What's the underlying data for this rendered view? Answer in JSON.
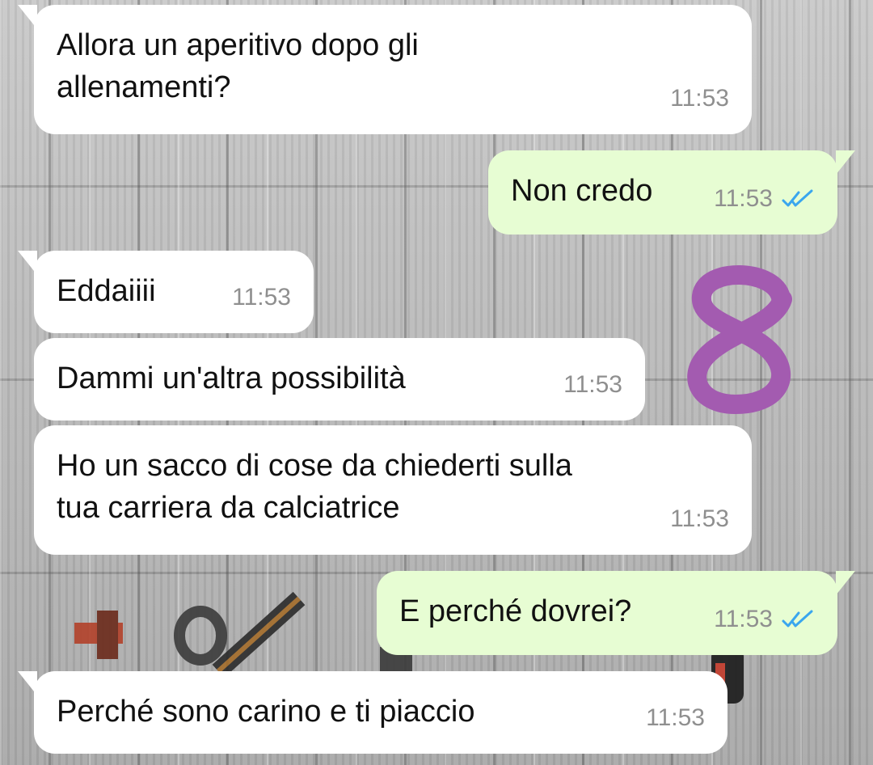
{
  "messages": [
    {
      "direction": "incoming",
      "text": "Allora un aperitivo dopo gli\nallenamenti?",
      "time": "11:53"
    },
    {
      "direction": "outgoing",
      "text": "Non credo",
      "time": "11:53",
      "status": "read-double-tick"
    },
    {
      "direction": "incoming",
      "text": "Eddaiiii",
      "time": "11:53"
    },
    {
      "direction": "incoming",
      "text": "Dammi un'altra possibilità",
      "time": "11:53"
    },
    {
      "direction": "incoming",
      "text": "Ho un sacco di cose da chiederti sulla\ntua carriera da calciatrice",
      "time": "11:53"
    },
    {
      "direction": "outgoing",
      "text": "E perché dovrei?",
      "time": "11:53",
      "status": "read-double-tick"
    },
    {
      "direction": "incoming",
      "text": "Perché sono carino e ti piaccio",
      "time": "11:53"
    }
  ],
  "overlay": {
    "annotation": "8",
    "annotation_color": "#a35bb0"
  },
  "colors": {
    "incoming_bubble": "#ffffff",
    "outgoing_bubble": "#e7fdd3",
    "timestamp": "#8f8f8f",
    "read_ticks": "#3aa6ee"
  }
}
